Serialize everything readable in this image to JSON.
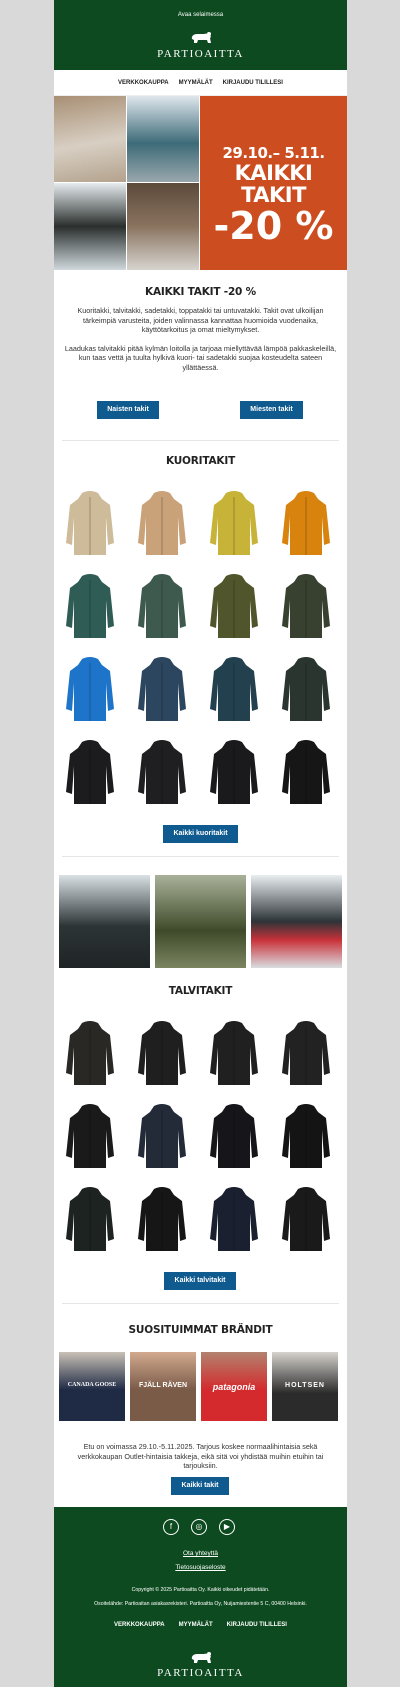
{
  "header": {
    "browser_link": "Avaa selaimessa",
    "logo": "PARTIOAITTA"
  },
  "nav": {
    "items": [
      "VERKKOKAUPPA",
      "MYYMÄLÄT",
      "KIRJAUDU TILILLESI"
    ]
  },
  "hero": {
    "dates": "29.10.– 5.11.",
    "headline": "KAIKKI TAKIT",
    "discount": "-20 %"
  },
  "intro": {
    "title": "KAIKKI TAKIT -20 %",
    "p1": "Kuoritakki, talvitakki, sadetakki, toppatakki tai untuvatakki. Takit ovat ulkoilijan tärkeimpiä varusteita, joiden valinnassa kannattaa huomioida vuodenaika, käyttötarkoitus ja omat mieltymykset.",
    "p2": "Laadukas talvitakki pitää kylmän loitolla ja tarjoaa miellyttävää lämpöä pakkaskeleillä, kun taas vettä ja tuulta hylkivä kuori- tai sadetakki suojaa kosteudelta sateen yllättäessä.",
    "btn_women": "Naisten takit",
    "btn_men": "Miesten takit"
  },
  "shell": {
    "title": "KUORITAKIT",
    "button": "Kaikki kuoritakit",
    "colors": [
      "#cdbb9a",
      "#c9a27a",
      "#c7b338",
      "#d9830f",
      "#2f5c55",
      "#3e5a4e",
      "#50552b",
      "#38402f",
      "#1e74c8",
      "#2d4660",
      "#22404e",
      "#2b3530",
      "#1c1c1f",
      "#1f1f22",
      "#1a1a1c",
      "#161617"
    ]
  },
  "winter": {
    "title": "TALVITAKIT",
    "button": "Kaikki talvitakit",
    "colors": [
      "#2a2825",
      "#1f1f20",
      "#202020",
      "#222222",
      "#1a1a1a",
      "#232a38",
      "#16161a",
      "#141414",
      "#1d2320",
      "#161616",
      "#1b2030",
      "#1a1a1a"
    ]
  },
  "brands": {
    "title": "SUOSITUIMMAT BRÄNDIT",
    "items": [
      "CANADA GOOSE",
      "FJÄLL RÄVEN",
      "patagonia",
      "HOLTSEN"
    ]
  },
  "terms": {
    "text": "Etu on voimassa 29.10.-5.11.2025. Tarjous koskee normaalihintaisia sekä verkkokaupan Outlet-hintaisia takkeja, eikä sitä voi yhdistää muihin etuihin tai tarjouksiin.",
    "button": "Kaikki takit"
  },
  "footer": {
    "social": [
      "f",
      "◎",
      "▶"
    ],
    "contact": "Ota yhteyttä",
    "privacy": "Tietosuojaseloste",
    "copyright": "Copyright © 2025 Partioaitta Oy. Kaikki oikeudet pidätetään.",
    "sender": "Osoitelähde: Partioaitan asiakasrekisteri. Partioaitta Oy, Nuijamiestentie 5 C, 00400 Helsinki.",
    "nav": [
      "VERKKOKAUPPA",
      "MYYMÄLÄT",
      "KIRJAUDU TILILLESI"
    ],
    "logo": "PARTIOAITTA"
  }
}
